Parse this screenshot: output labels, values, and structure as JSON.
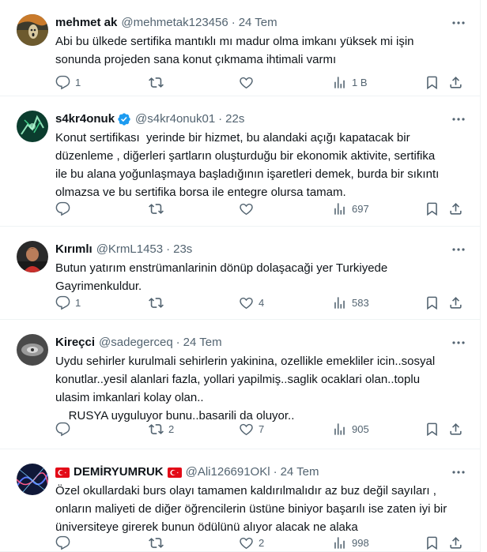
{
  "tweets": [
    {
      "display_name": "mehmet ak",
      "handle": "@mehmetak123456",
      "dot": "·",
      "time": "24 Tem",
      "text": "Abi bu ülkede sertifika mantıklı mı madur olma imkanı yüksek mi işin\nsonunda projeden sana konut çıkmama ihtimali varmı",
      "replies": "1",
      "retweets": "",
      "likes": "",
      "views": "1 B",
      "verified": false
    },
    {
      "display_name": "s4kr4onuk",
      "handle": "@s4kr4onuk01",
      "dot": "·",
      "time": "22s",
      "text": "Konut sertifikası  yerinde bir hizmet, bu alandaki açığı kapatacak bir\ndüzenleme , diğerleri şartların oluşturduğu bir ekonomik aktivite, sertifika\nile bu alana yoğunlaşmaya başladığının işaretleri demek, burda bir sıkıntı\nolmazsa ve bu sertifika borsa ile entegre olursa tamam.",
      "replies": "",
      "retweets": "",
      "likes": "",
      "views": "697",
      "verified": true
    },
    {
      "display_name": "Kırımlı",
      "handle": "@KrmL1453",
      "dot": "·",
      "time": "23s",
      "text": "Butun yatırım enstrümanlarinin dönüp dolaşacaği yer Turkiyede\nGayrimenkuldur.",
      "replies": "1",
      "retweets": "",
      "likes": "4",
      "views": "583",
      "verified": false
    },
    {
      "display_name": "Kireçci",
      "handle": "@sadegerceq",
      "dot": "·",
      "time": "24 Tem",
      "text": "Uydu sehirler kurulmali sehirlerin yakinina, ozellikle emekliler icin..sosyal\nkonutlar..yesil alanlari fazla, yollari yapilmiş..saglik ocaklari olan..toplu\nulasim imkanlari kolay olan..\n    RUSYA uyguluyor bunu..basarili da oluyor..",
      "replies": "",
      "retweets": "2",
      "likes": "7",
      "views": "905",
      "verified": false
    },
    {
      "display_name": "DEMİRYUMRUK",
      "handle": "@Ali126691OKl",
      "dot": "·",
      "time": "24 Tem",
      "text": "Özel okullardaki burs olayı tamamen kaldırılmalıdır az buz değil sayıları ,\nonların maliyeti de diğer öğrencilerin üstüne biniyor başarılı ise zaten iyi bir\nüniversiteye girerek bunun ödülünü alıyor alacak ne alaka",
      "replies": "",
      "retweets": "",
      "likes": "2",
      "views": "998",
      "verified": false
    }
  ],
  "icons": {
    "reply": "reply-icon",
    "retweet": "retweet-icon",
    "like": "heart-icon",
    "views": "views-icon",
    "bookmark": "bookmark-icon",
    "share": "share-icon",
    "more": "more-icon",
    "verified": "verified-badge-icon",
    "flag": "turkey-flag-icon"
  },
  "colors": {
    "text": "#0f1419",
    "muted": "#536471",
    "verified": "#1d9bf0",
    "divider": "#eff3f4"
  }
}
